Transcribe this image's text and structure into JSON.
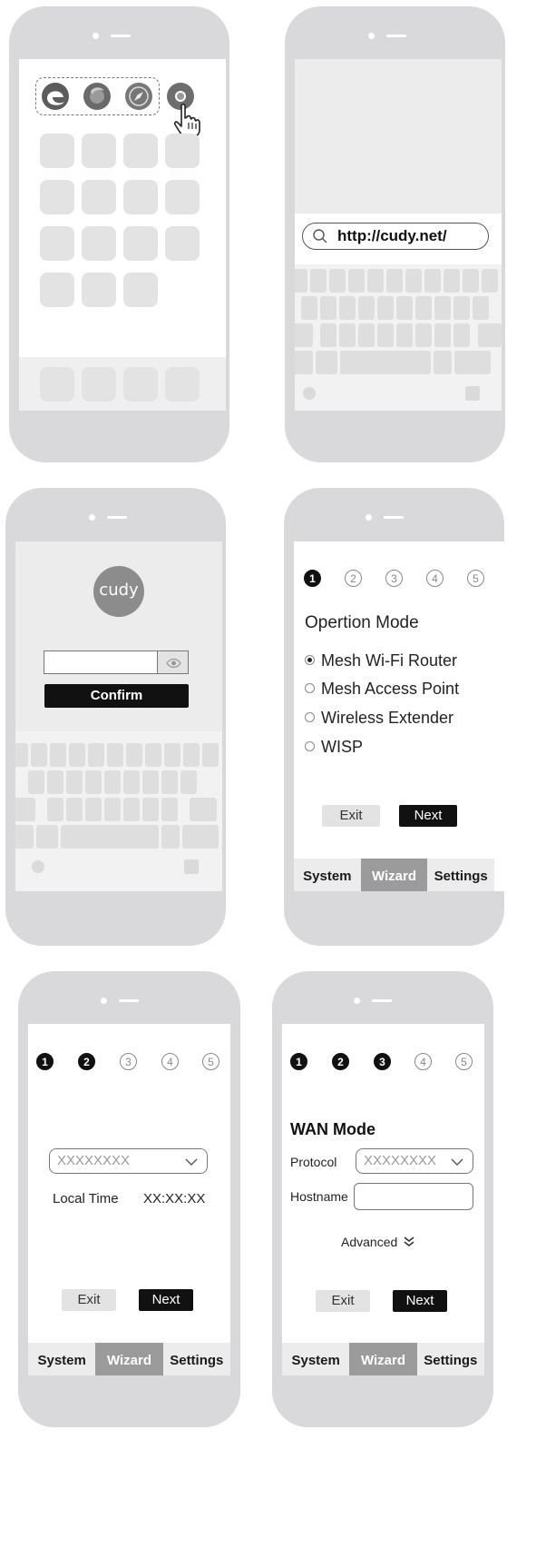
{
  "panel1": {
    "browsers": [
      "edge-icon",
      "firefox-icon",
      "safari-icon",
      "chrome-icon"
    ]
  },
  "panel2": {
    "url": "http://cudy.net/"
  },
  "panel3": {
    "logo": "cudy",
    "password_value": "",
    "confirm_label": "Confirm"
  },
  "panel4": {
    "steps": [
      "1",
      "2",
      "3",
      "4",
      "5"
    ],
    "completed_steps": 1,
    "heading": "Opertion Mode",
    "options": [
      "Mesh Wi-Fi Router",
      "Mesh Access Point",
      "Wireless Extender",
      "WISP"
    ],
    "selected_option": "Mesh Wi-Fi Router",
    "exit_label": "Exit",
    "next_label": "Next",
    "tabs": [
      "System",
      "Wizard",
      "Settings"
    ],
    "active_tab": "Wizard"
  },
  "panel5": {
    "steps": [
      "1",
      "2",
      "3",
      "4",
      "5"
    ],
    "completed_steps": 2,
    "timezone_value": "XXXXXXXX",
    "local_time_label": "Local Time",
    "local_time_value": "XX:XX:XX",
    "exit_label": "Exit",
    "next_label": "Next",
    "tabs": [
      "System",
      "Wizard",
      "Settings"
    ],
    "active_tab": "Wizard"
  },
  "panel6": {
    "steps": [
      "1",
      "2",
      "3",
      "4",
      "5"
    ],
    "completed_steps": 3,
    "heading": "WAN Mode",
    "protocol_label": "Protocol",
    "protocol_value": "XXXXXXXX",
    "hostname_label": "Hostname",
    "hostname_value": "",
    "advanced_label": "Advanced",
    "exit_label": "Exit",
    "next_label": "Next",
    "tabs": [
      "System",
      "Wizard",
      "Settings"
    ],
    "active_tab": "Wizard"
  }
}
